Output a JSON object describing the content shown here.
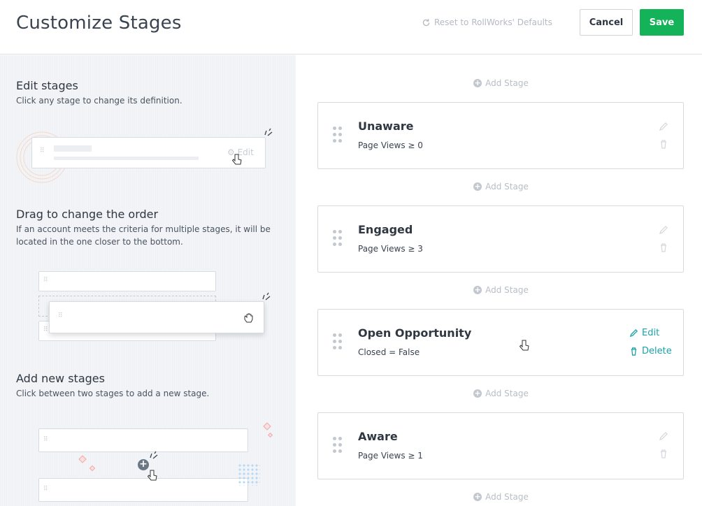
{
  "header": {
    "title": "Customize Stages",
    "reset_label": "Reset to RollWorks' Defaults",
    "cancel_label": "Cancel",
    "save_label": "Save"
  },
  "tips": [
    {
      "title": "Edit stages",
      "description": "Click any stage to change its definition.",
      "illustration_edit_label": "Edit"
    },
    {
      "title": "Drag to change the order",
      "description": "If an account meets the criteria for multiple stages, it will be located in the one closer to the bottom."
    },
    {
      "title": "Add new stages",
      "description": "Click between two stages to add a new stage."
    }
  ],
  "add_stage_label": "Add Stage",
  "stages": [
    {
      "name": "Unaware",
      "rule": "Page Views ≥ 0"
    },
    {
      "name": "Engaged",
      "rule": "Page Views ≥ 3"
    },
    {
      "name": "Open Opportunity",
      "rule": "Closed = False",
      "edit_label": "Edit",
      "delete_label": "Delete"
    },
    {
      "name": "Aware",
      "rule": "Page Views ≥ 1"
    }
  ],
  "colors": {
    "save": "#14b35a",
    "action_teal": "#1aa2a8",
    "muted": "#b8bec6"
  },
  "icons": [
    "refresh-icon",
    "grip-icon",
    "pencil-icon",
    "trash-icon",
    "plus-circle-icon",
    "hand-cursor-icon",
    "grab-cursor-icon"
  ]
}
